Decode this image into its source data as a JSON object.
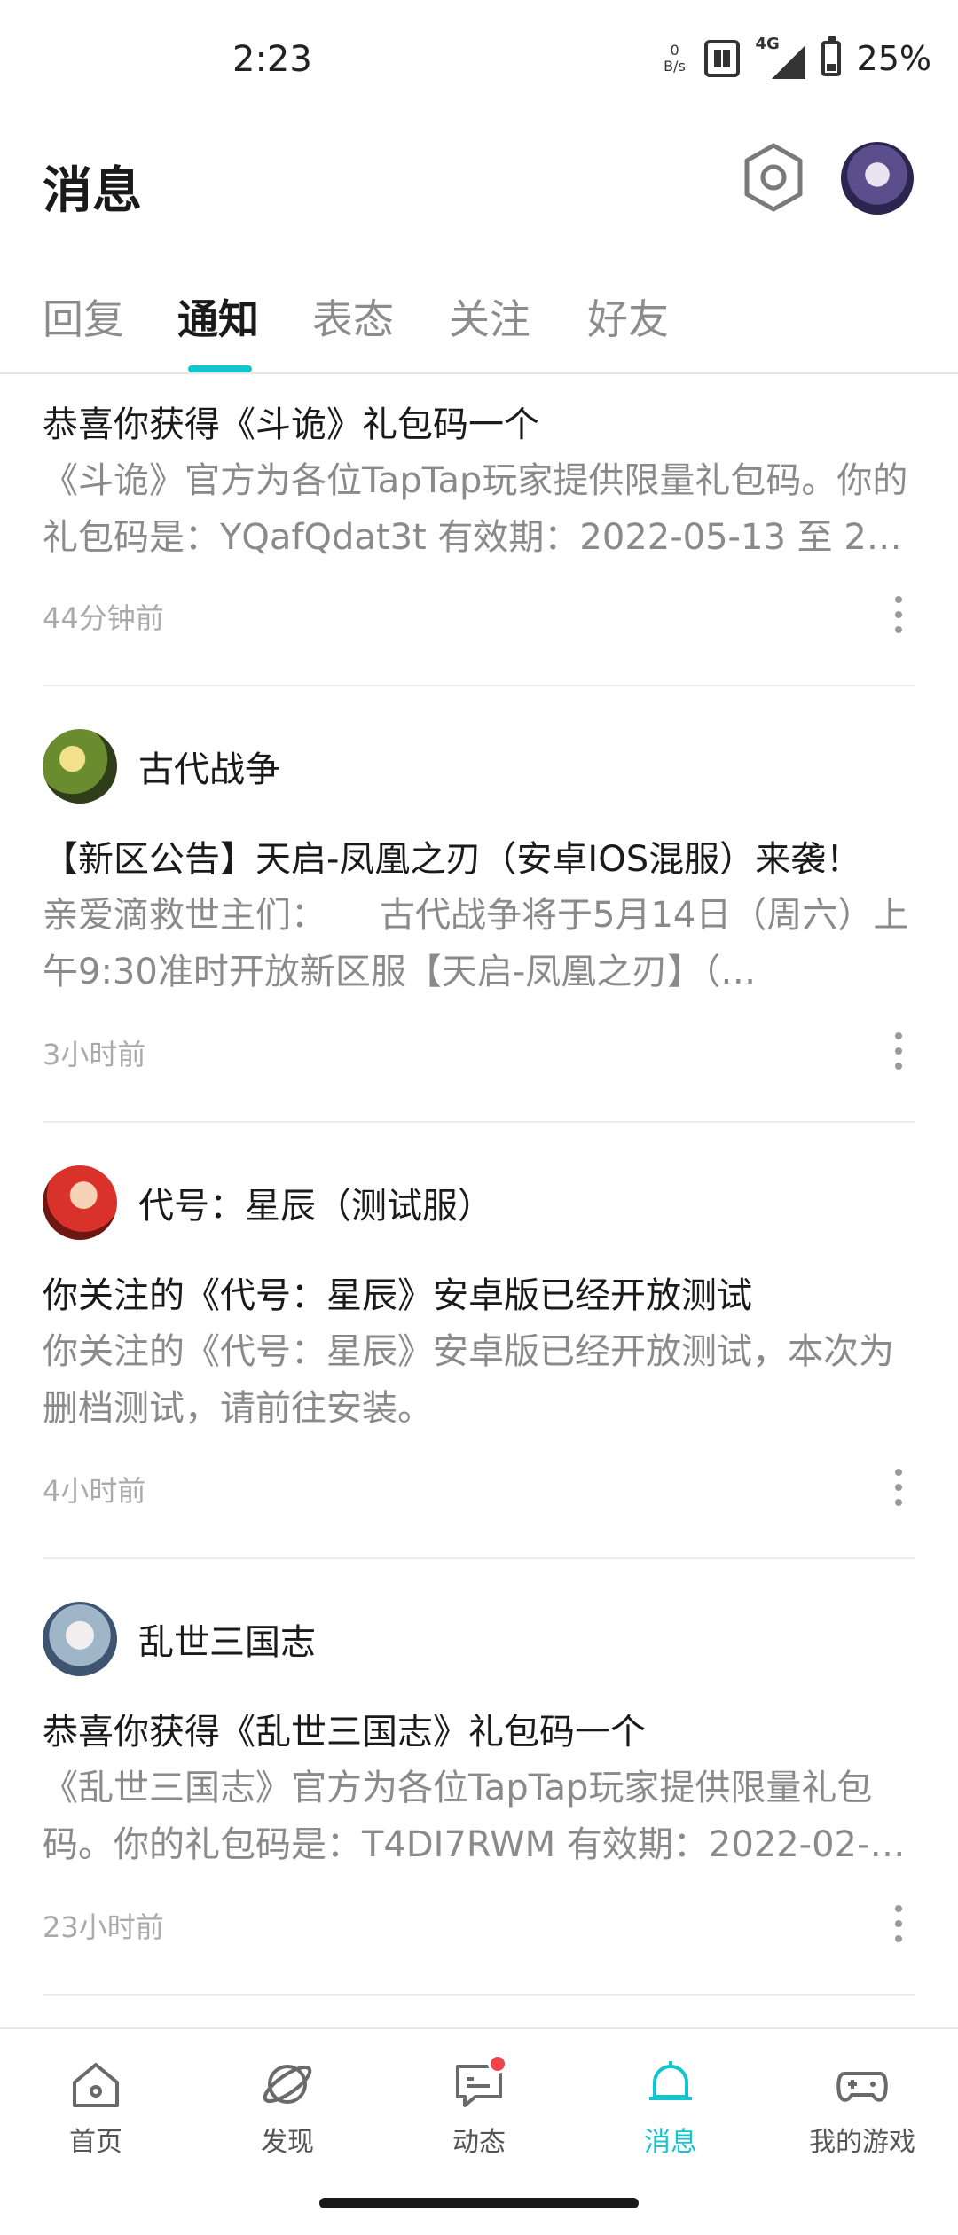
{
  "status_bar": {
    "time": "2:23",
    "net_speed_value": "0",
    "net_speed_unit": "B/s",
    "network_type": "4G",
    "battery": "25%"
  },
  "header": {
    "title": "消息",
    "settings_icon": "gear-icon",
    "avatar_icon": "user-avatar"
  },
  "tabs": [
    {
      "label": "回复",
      "active": false
    },
    {
      "label": "通知",
      "active": true
    },
    {
      "label": "表态",
      "active": false
    },
    {
      "label": "关注",
      "active": false
    },
    {
      "label": "好友",
      "active": false
    }
  ],
  "notifications": [
    {
      "sender": "",
      "title": "恭喜你获得《斗诡》礼包码一个",
      "body": "《斗诡》官方为各位TapTap玩家提供限量礼包码。你的礼包码是：YQafQdat3t 有效期：2022-05-13 至 2…",
      "time": "44分钟前"
    },
    {
      "sender": "古代战争",
      "title": "【新区公告】天启-凤凰之刃（安卓IOS混服）来袭！",
      "body": "亲爱滴救世主们：　　古代战争将于5月14日（周六）上午9:30准时开放新区服【天启-凤凰之刃】（…",
      "time": "3小时前"
    },
    {
      "sender": "代号：星辰（测试服）",
      "title": "你关注的《代号：星辰》安卓版已经开放测试",
      "body": "你关注的《代号：星辰》安卓版已经开放测试，本次为删档测试，请前往安装。",
      "time": "4小时前"
    },
    {
      "sender": "乱世三国志",
      "title": "恭喜你获得《乱世三国志》礼包码一个",
      "body": "《乱世三国志》官方为各位TapTap玩家提供限量礼包码。你的礼包码是：T4DI7RWM 有效期：2022-02-…",
      "time": "23小时前"
    }
  ],
  "bottom_nav": [
    {
      "label": "首页",
      "icon": "home-icon",
      "active": false
    },
    {
      "label": "发现",
      "icon": "planet-icon",
      "active": false
    },
    {
      "label": "动态",
      "icon": "chat-icon",
      "active": false,
      "badge": true
    },
    {
      "label": "消息",
      "icon": "bell-icon",
      "active": true
    },
    {
      "label": "我的游戏",
      "icon": "gamepad-icon",
      "active": false
    }
  ],
  "colors": {
    "accent": "#15c5ce",
    "badge": "#f2434b",
    "text_primary": "#1a1a1a",
    "text_secondary": "#8a8a8a"
  }
}
